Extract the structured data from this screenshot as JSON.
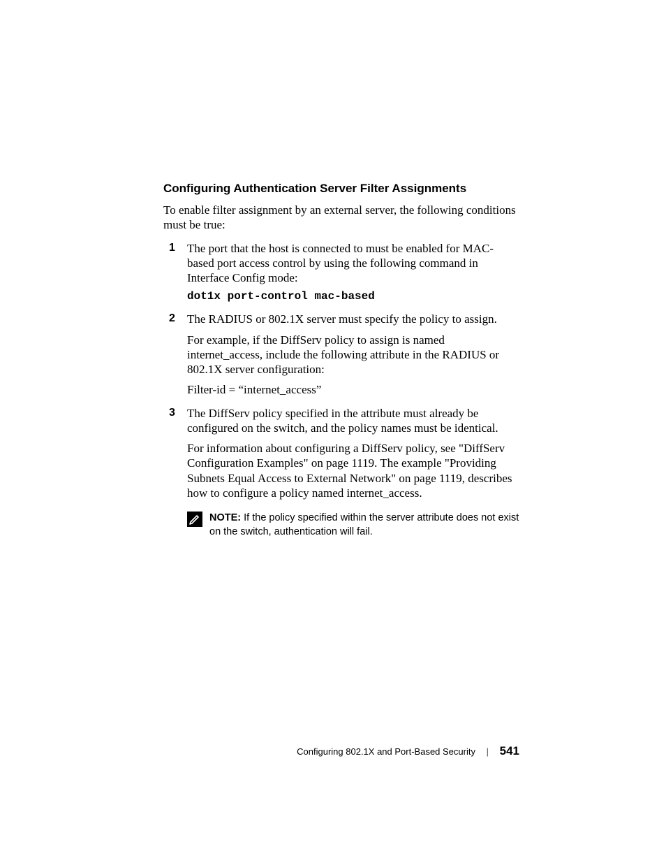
{
  "section_title": "Configuring Authentication Server Filter Assignments",
  "intro": "To enable filter assignment by an external server, the following conditions must be true:",
  "steps": {
    "s1": {
      "text": "The port that the host is connected to must be enabled for MAC-based port access control by using the following command in Interface Config mode:",
      "command": "dot1x port-control mac-based"
    },
    "s2": {
      "text": "The RADIUS or 802.1X server must specify the policy to assign.",
      "para1": "For example, if the DiffServ policy to assign is named internet_access, include the following attribute in the RADIUS or 802.1X server configuration:",
      "para2": "Filter-id = “internet_access”"
    },
    "s3": {
      "text": "The DiffServ policy specified in the attribute must already be configured on the switch, and the policy names must be identical.",
      "para1": "For information about configuring a DiffServ policy, see \"DiffServ Configuration Examples\" on page 1119. The example \"Providing Subnets Equal Access to External Network\" on page 1119, describes how to configure a policy named internet_access."
    }
  },
  "note": {
    "label": "NOTE:",
    "text": " If the policy specified within the server attribute does not exist on the switch, authentication will fail."
  },
  "footer": {
    "chapter": "Configuring 802.1X and Port-Based Security",
    "page": "541"
  }
}
